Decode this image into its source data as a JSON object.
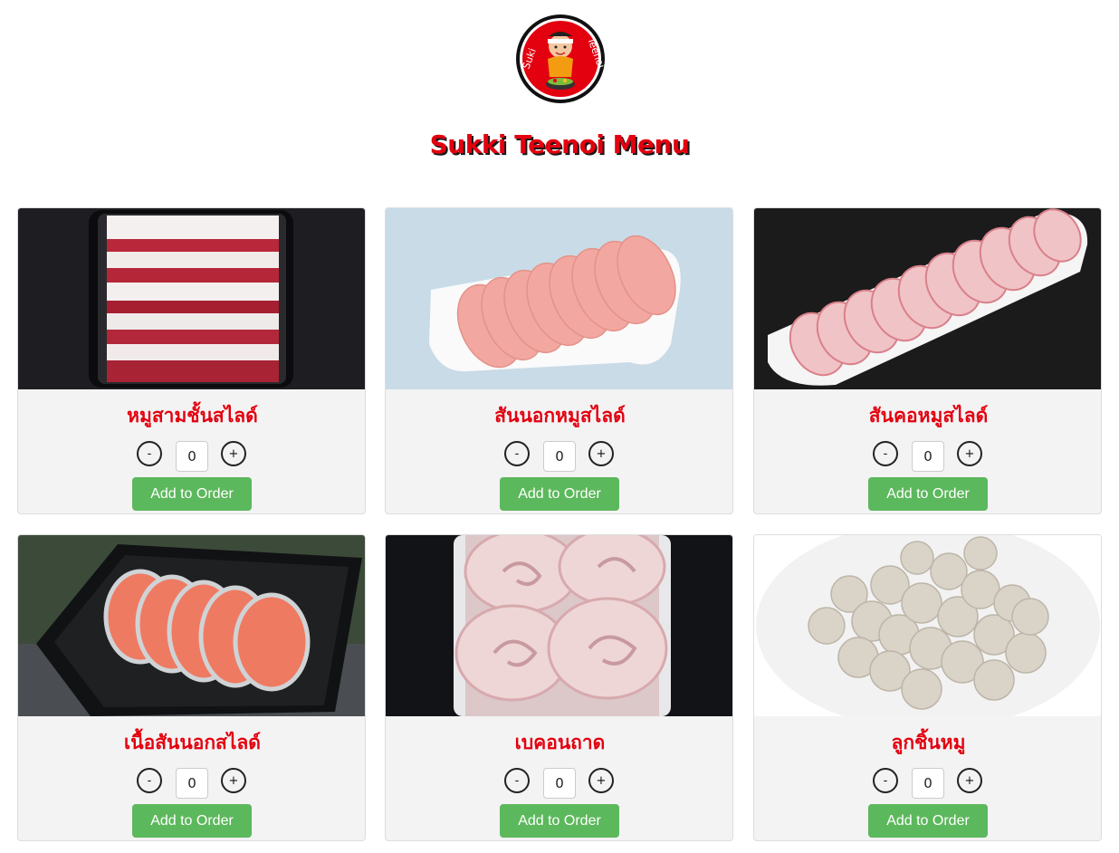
{
  "header": {
    "logo": {
      "text_left": "Suki",
      "text_right": "Teenoi"
    },
    "title": "Sukki Teenoi Menu"
  },
  "menu": {
    "items": [
      {
        "name": "หมูสามชั้นสไลด์",
        "quantity": "0",
        "minus_label": "-",
        "plus_label": "+",
        "button_label": "Add to Order"
      },
      {
        "name": "สันนอกหมูสไลด์",
        "quantity": "0",
        "minus_label": "-",
        "plus_label": "+",
        "button_label": "Add to Order"
      },
      {
        "name": "สันคอหมูสไลด์",
        "quantity": "0",
        "minus_label": "-",
        "plus_label": "+",
        "button_label": "Add to Order"
      },
      {
        "name": "เนื้อสันนอกสไลด์",
        "quantity": "0",
        "minus_label": "-",
        "plus_label": "+",
        "button_label": "Add to Order"
      },
      {
        "name": "เบคอนถาด",
        "quantity": "0",
        "minus_label": "-",
        "plus_label": "+",
        "button_label": "Add to Order"
      },
      {
        "name": "ลูกชิ้นหมู",
        "quantity": "0",
        "minus_label": "-",
        "plus_label": "+",
        "button_label": "Add to Order"
      }
    ]
  },
  "colors": {
    "title_red": "#e3000f",
    "button_green": "#5cb85c",
    "card_bg": "#f3f3f3"
  }
}
